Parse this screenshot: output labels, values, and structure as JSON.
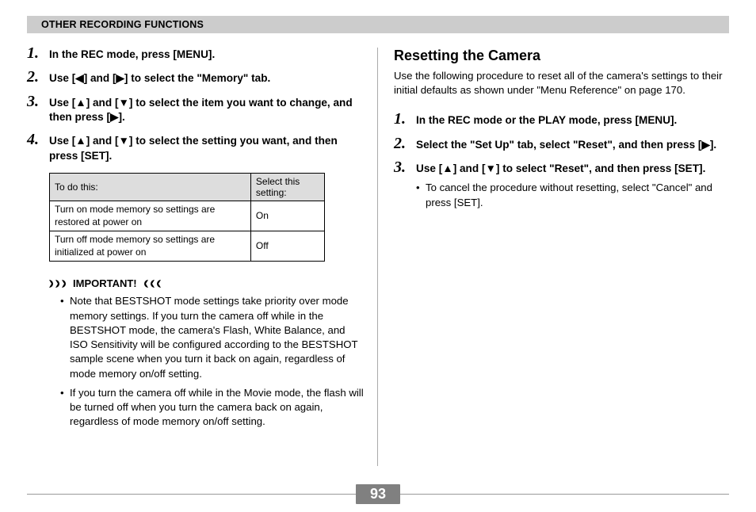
{
  "header": "OTHER RECORDING FUNCTIONS",
  "glyphs": {
    "up": "▲",
    "down": "▼",
    "left": "◀",
    "right": "▶"
  },
  "left": {
    "steps": [
      "In the REC mode, press [MENU].",
      "Use [◀] and [▶] to select the \"Memory\" tab.",
      "Use [▲] and [▼] to select the item you want to change, and then press [▶].",
      "Use [▲] and [▼] to select the setting you want, and then press [SET]."
    ],
    "table": {
      "head": [
        "To do this:",
        "Select this setting:"
      ],
      "rows": [
        [
          "Turn on mode memory so settings are restored at power on",
          "On"
        ],
        [
          "Turn off mode memory so settings are initialized at power on",
          "Off"
        ]
      ]
    },
    "important_label": "IMPORTANT!",
    "notes": [
      "Note that BESTSHOT mode settings take priority over mode memory settings. If you turn the camera off while in the BESTSHOT mode, the camera's Flash, White Balance, and ISO Sensitivity will be configured according to the BESTSHOT sample scene when you turn it back on again, regardless of mode memory on/off setting.",
      "If you turn the camera off while in the Movie mode, the flash will be turned off when you turn the camera back on again, regardless of mode memory on/off setting."
    ]
  },
  "right": {
    "heading": "Resetting the Camera",
    "intro": "Use the following procedure to reset all of the camera's settings to their initial defaults as shown under \"Menu Reference\" on page 170.",
    "steps": [
      "In the REC mode or the PLAY mode, press [MENU].",
      "Select the \"Set Up\" tab, select \"Reset\", and then press [▶].",
      "Use [▲] and [▼] to select \"Reset\", and then press [SET]."
    ],
    "sub_notes": [
      "To cancel the procedure without resetting, select \"Cancel\" and press [SET]."
    ]
  },
  "page_number": "93"
}
